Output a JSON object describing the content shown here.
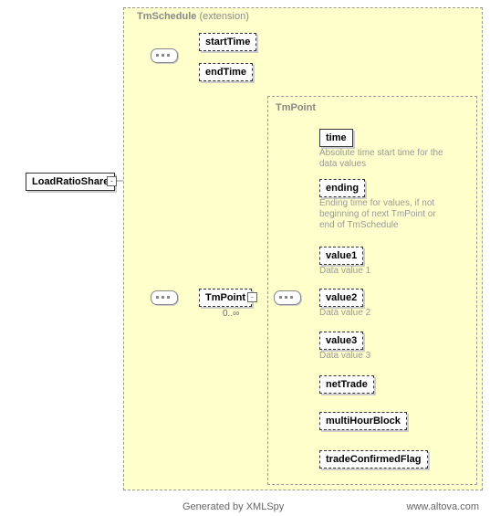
{
  "root": {
    "name": "LoadRatioShare"
  },
  "outer": {
    "title": "TmSchedule",
    "ext": "(extension)"
  },
  "seq1": {
    "items": [
      {
        "name": "startTime"
      },
      {
        "name": "endTime"
      }
    ]
  },
  "seq2": {
    "name": "TmPoint",
    "card": "0..∞"
  },
  "inner": {
    "title": "TmPoint",
    "items": [
      {
        "name": "time",
        "desc": "Absolute time start time for the data values"
      },
      {
        "name": "ending",
        "desc": "Ending time for values, if not beginning of next TmPoint or end of TmSchedule"
      },
      {
        "name": "value1",
        "desc": "Data value 1"
      },
      {
        "name": "value2",
        "desc": "Data value 2"
      },
      {
        "name": "value3",
        "desc": "Data value 3"
      },
      {
        "name": "netTrade"
      },
      {
        "name": "multiHourBlock"
      },
      {
        "name": "tradeConfirmedFlag"
      }
    ]
  },
  "footer": {
    "gen": "Generated by XMLSpy",
    "link": "www.altova.com"
  }
}
